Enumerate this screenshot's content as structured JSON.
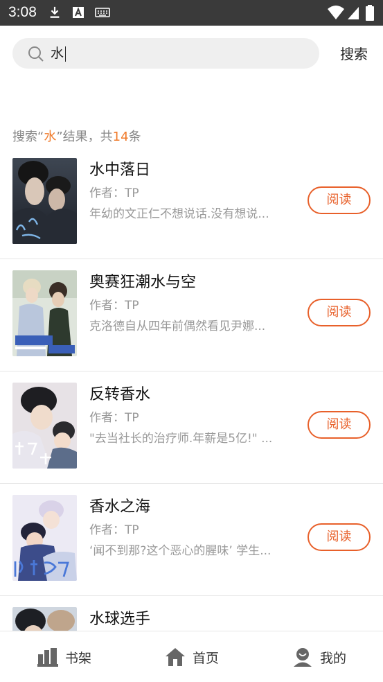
{
  "status_bar": {
    "time": "3:08"
  },
  "search": {
    "query": "水",
    "button_label": "搜索"
  },
  "summary": {
    "prefix": "搜索“",
    "keyword": "水",
    "middle": "”结果，共",
    "count": "14",
    "suffix": "条"
  },
  "results": [
    {
      "title": "水中落日",
      "author": "作者：TP",
      "desc": "年幼的文正仁不想说话.没有想说...",
      "read_label": "阅读"
    },
    {
      "title": "奥赛狂潮水与空",
      "author": "作者：TP",
      "desc": "克洛德自从四年前偶然看见尹娜...",
      "read_label": "阅读"
    },
    {
      "title": "反转香水",
      "author": "作者：TP",
      "desc": "\"去当社长的治疗师.年薪是5亿!\" ...",
      "read_label": "阅读"
    },
    {
      "title": "香水之海",
      "author": "作者：TP",
      "desc": "‘闻不到那?这个恶心的腥味’ 学生...",
      "read_label": "阅读"
    },
    {
      "title": "水球选手",
      "author": "",
      "desc": "",
      "read_label": ""
    }
  ],
  "bottom_nav": [
    {
      "label": "书架",
      "icon": "bookshelf-icon"
    },
    {
      "label": "首页",
      "icon": "home-icon"
    },
    {
      "label": "我的",
      "icon": "profile-icon"
    }
  ],
  "colors": {
    "accent": "#e8602a",
    "highlight": "#f07a2a",
    "status_bar": "#3a3a3a"
  }
}
